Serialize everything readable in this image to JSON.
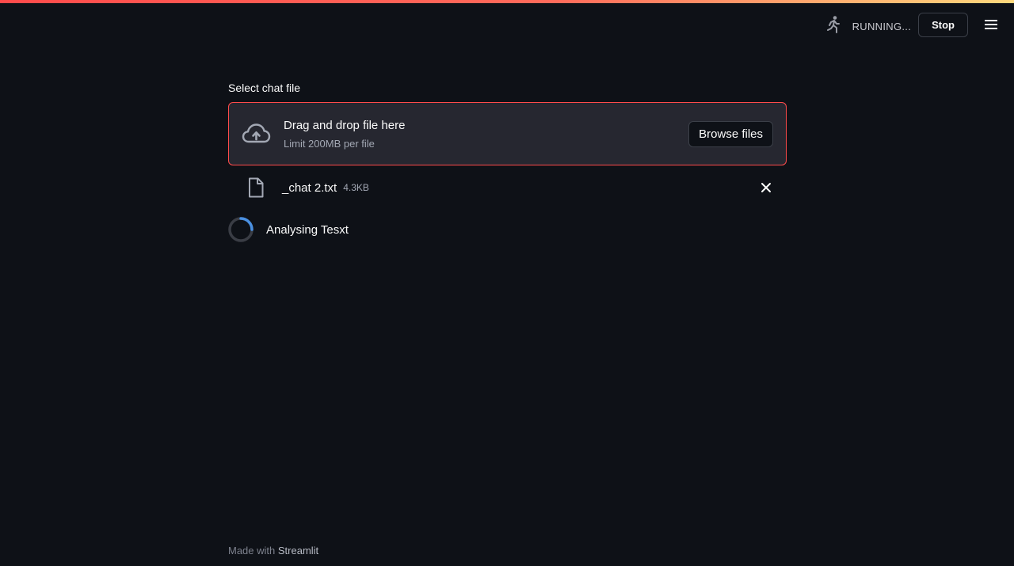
{
  "header": {
    "status_label": "RUNNING...",
    "stop_label": "Stop",
    "status_icon": "running-man-icon",
    "menu_icon": "hamburger-menu-icon"
  },
  "uploader": {
    "label": "Select chat file",
    "drop_title": "Drag and drop file here",
    "drop_limit": "Limit 200MB per file",
    "browse_label": "Browse files",
    "upload_icon": "cloud-upload-icon"
  },
  "uploaded_file": {
    "name": "_chat 2.txt",
    "size": "4.3KB",
    "icon": "file-icon",
    "remove_icon": "close-icon"
  },
  "spinner": {
    "text": "Analysing Tesxt"
  },
  "footer": {
    "prefix": "Made with",
    "brand": "Streamlit"
  },
  "colors": {
    "background": "#0e1117",
    "surface": "#262730",
    "accent": "#ff4b4b",
    "spinner_blue": "#4a90e2"
  }
}
